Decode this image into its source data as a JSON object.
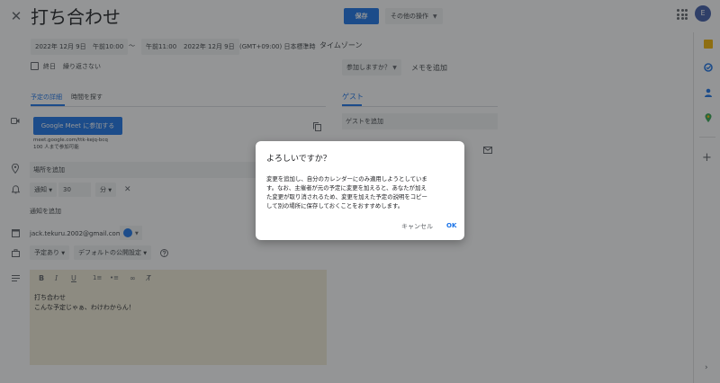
{
  "header": {
    "close_glyph": "✕",
    "title": "打ち合わせ",
    "save_label": "保存",
    "more_label": "その他の操作",
    "avatar_letter": "E"
  },
  "datetime": {
    "start_date": "2022年 12月 9日",
    "start_time": "午前10:00",
    "separator": "〜",
    "end_time": "午前11:00",
    "end_date": "2022年 12月 9日",
    "timezone": "(GMT+09:00) 日本標準時",
    "timezone_link": "タイムゾーン",
    "allday_label": "終日",
    "repeat_label": "繰り返さない"
  },
  "rsvp": {
    "going_label": "参加しますか？",
    "add_note": "メモを追加"
  },
  "tabs": {
    "details": "予定の詳細",
    "find_time": "時間を探す",
    "guests": "ゲスト"
  },
  "details": {
    "meet_label": "Google Meet に参加する",
    "meet_url": "meet.google.com/ttk-kejq-bcq",
    "meet_capacity": "100 人まで参加可能",
    "location_placeholder": "場所を追加",
    "notification_type": "通知",
    "notification_value": "30",
    "notification_unit": "分",
    "add_notification": "通知を追加",
    "calendar_owner": "jack.tekuru.2002@gmail.com",
    "busy_label": "予定あり",
    "visibility_label": "デフォルトの公開設定",
    "description_line1": "打ち合わせ",
    "description_line2": "こんな予定じゃぁ、わけわからん！"
  },
  "guests": {
    "add_placeholder": "ゲストを追加"
  },
  "dialog": {
    "title": "よろしいですか？",
    "line1": "変更を追加し、自分のカレンダーにのみ適用しようとしていま",
    "line2": "す。なお、主催者が元の予定に変更を加えると、あなたが加え",
    "line3": "た変更が取り消されるため、変更を加えた予定の説明をコピー",
    "line4": "して別の場所に保存しておくことをおすすめします。",
    "cancel_label": "キャンセル",
    "ok_label": "OK"
  },
  "colors": {
    "accent": "#1a73e8",
    "description_bg": "#f1ecd7",
    "overlay": "rgba(32,33,36,0.48)"
  }
}
